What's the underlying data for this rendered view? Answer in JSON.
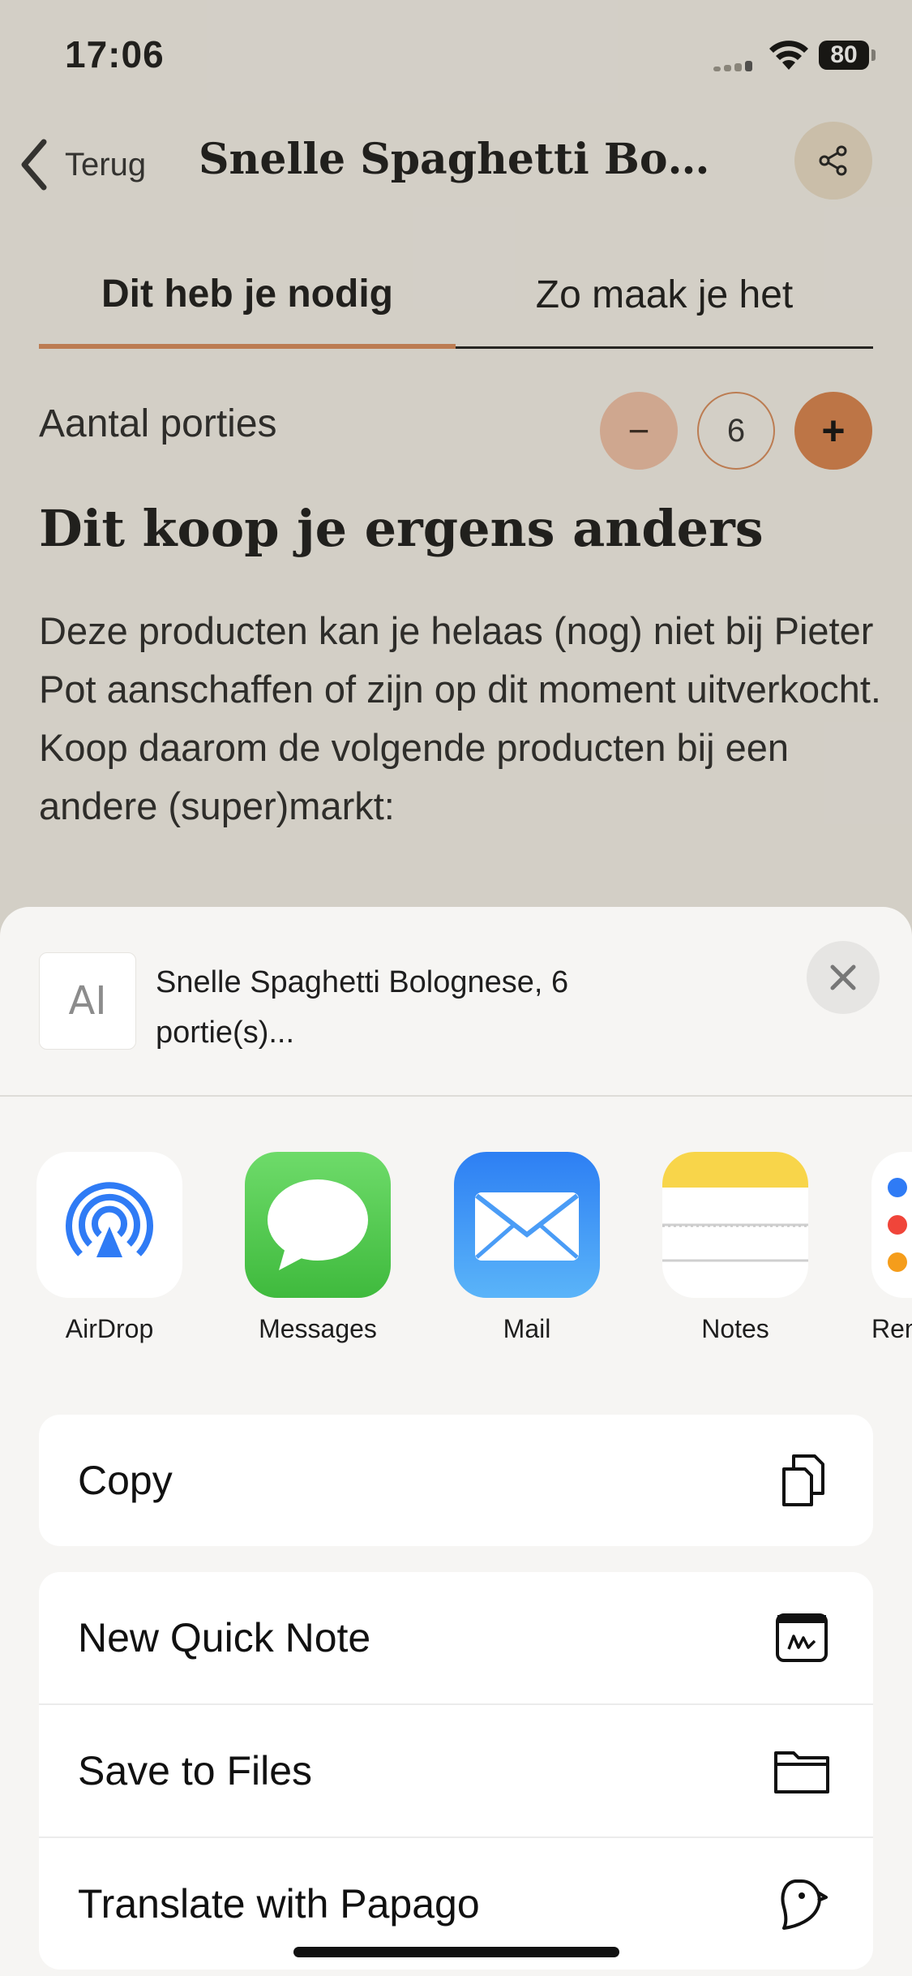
{
  "status_bar": {
    "time": "17:06",
    "battery": "80"
  },
  "nav": {
    "back_label": "Terug",
    "title": "Snelle Spaghetti Bologn…"
  },
  "tabs": [
    {
      "label": "Dit heb je nodig"
    },
    {
      "label": "Zo maak je het"
    }
  ],
  "portions": {
    "label": "Aantal porties",
    "minus": "−",
    "value": "6",
    "plus": "+"
  },
  "section": {
    "title": "Dit koop je ergens anders",
    "body": "Deze producten kan je helaas (nog) niet bij Pieter Pot aanschaffen of zijn op dit moment uitverkocht. Koop daarom de volgende producten bij een andere (super)markt:"
  },
  "share_sheet": {
    "preview_glyph": "AI",
    "preview_title": "Snelle Spaghetti Bolognese, 6 portie(s)...",
    "apps": [
      {
        "label": "AirDrop",
        "icon": "airdrop-icon"
      },
      {
        "label": "Messages",
        "icon": "messages-icon"
      },
      {
        "label": "Mail",
        "icon": "mail-icon"
      },
      {
        "label": "Notes",
        "icon": "notes-icon"
      },
      {
        "label": "Reminders",
        "icon": "reminders-icon"
      }
    ],
    "actions_group1": [
      {
        "label": "Copy",
        "icon": "copy-icon"
      }
    ],
    "actions_group2": [
      {
        "label": "New Quick Note",
        "icon": "quick-note-icon"
      },
      {
        "label": "Save to Files",
        "icon": "folder-icon"
      },
      {
        "label": "Translate with Papago",
        "icon": "papago-icon"
      }
    ]
  },
  "colors": {
    "accent": "#D9834D",
    "accent_light": "#EFC0A7",
    "background": "#F4F1EA",
    "sheet": "#F6F5F3"
  }
}
